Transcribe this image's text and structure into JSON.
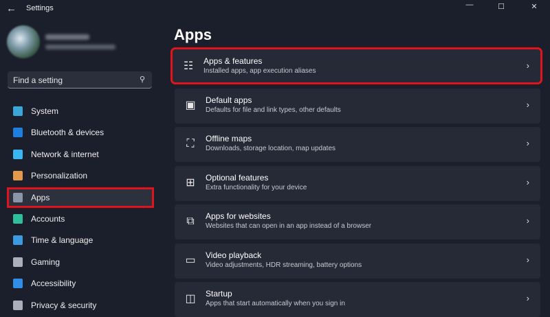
{
  "window": {
    "title": "Settings",
    "back": "←",
    "minimize": "—",
    "maximize": "☐",
    "close": "✕"
  },
  "search": {
    "placeholder": "Find a setting"
  },
  "sidebar": {
    "items": [
      {
        "label": "System",
        "color": "#3aa7d8"
      },
      {
        "label": "Bluetooth & devices",
        "color": "#1f7fe0"
      },
      {
        "label": "Network & internet",
        "color": "#3ab6f0"
      },
      {
        "label": "Personalization",
        "color": "#e49a4a"
      },
      {
        "label": "Apps",
        "color": "#8a96a8"
      },
      {
        "label": "Accounts",
        "color": "#2fbf9a"
      },
      {
        "label": "Time & language",
        "color": "#3c9be0"
      },
      {
        "label": "Gaming",
        "color": "#a9b0bb"
      },
      {
        "label": "Accessibility",
        "color": "#2f8fe8"
      },
      {
        "label": "Privacy & security",
        "color": "#a9b0bb"
      }
    ],
    "selected": "Apps"
  },
  "main": {
    "title": "Apps",
    "cards": [
      {
        "title": "Apps & features",
        "subtitle": "Installed apps, app execution aliases",
        "icon": "☷"
      },
      {
        "title": "Default apps",
        "subtitle": "Defaults for file and link types, other defaults",
        "icon": "▣"
      },
      {
        "title": "Offline maps",
        "subtitle": "Downloads, storage location, map updates",
        "icon": "⛶"
      },
      {
        "title": "Optional features",
        "subtitle": "Extra functionality for your device",
        "icon": "⊞"
      },
      {
        "title": "Apps for websites",
        "subtitle": "Websites that can open in an app instead of a browser",
        "icon": "⧉"
      },
      {
        "title": "Video playback",
        "subtitle": "Video adjustments, HDR streaming, battery options",
        "icon": "▭"
      },
      {
        "title": "Startup",
        "subtitle": "Apps that start automatically when you sign in",
        "icon": "◫"
      }
    ],
    "chevron": "›"
  }
}
